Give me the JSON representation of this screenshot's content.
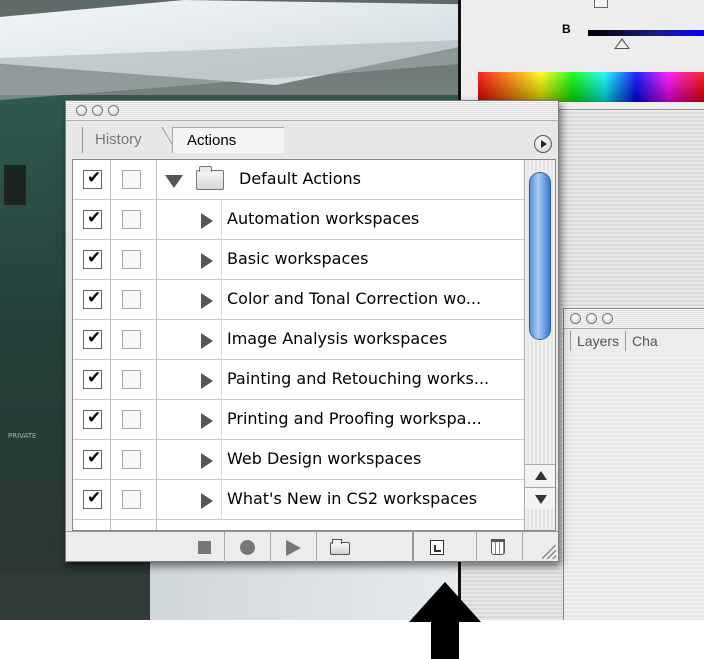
{
  "colors": {
    "scroll_thumb": "#6fa4e6",
    "panel_bg": "#e7e7e7",
    "arrow": "#000000"
  },
  "color_panel": {
    "channel_label": "B"
  },
  "layers_panel": {
    "tabs": [
      "Layers",
      "Cha"
    ]
  },
  "actions_panel": {
    "tabs": {
      "history": "History",
      "actions": "Actions"
    },
    "menu_icon": "panel-menu-arrow-icon",
    "set": {
      "name": "Default Actions",
      "expanded": true,
      "checked": true
    },
    "items": [
      {
        "label": "Automation workspaces",
        "checked": true
      },
      {
        "label": "Basic workspaces",
        "checked": true
      },
      {
        "label": "Color and Tonal Correction wo...",
        "checked": true
      },
      {
        "label": "Image Analysis workspaces",
        "checked": true
      },
      {
        "label": "Painting and Retouching works...",
        "checked": true
      },
      {
        "label": "Printing and Proofing workspa...",
        "checked": true
      },
      {
        "label": "Web Design workspaces",
        "checked": true
      },
      {
        "label": "What's New in CS2 workspaces",
        "checked": true
      }
    ],
    "toolbar_icons": [
      "stop-icon",
      "record-icon",
      "play-icon",
      "new-set-folder-icon",
      "new-action-icon",
      "trash-icon"
    ]
  },
  "photo": {
    "faint_text": "PRIVATE"
  },
  "annotation": {
    "icon": "up-arrow-icon"
  }
}
